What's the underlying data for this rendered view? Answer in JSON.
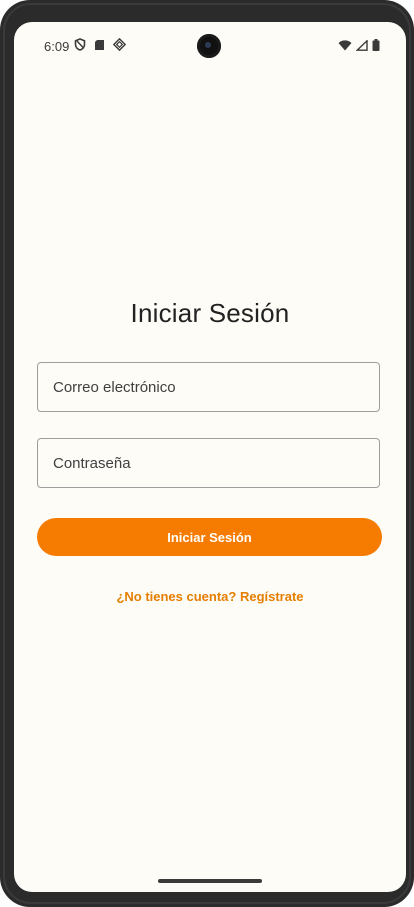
{
  "status_bar": {
    "time": "6:09",
    "left_icons": [
      "shield-icon",
      "sd-card-icon",
      "assistant-icon"
    ],
    "right_icons": [
      "wifi-icon",
      "cell-signal-icon",
      "battery-icon"
    ]
  },
  "login": {
    "title": "Iniciar Sesión",
    "email_placeholder": "Correo electrónico",
    "password_placeholder": "Contraseña",
    "submit_label": "Iniciar Sesión",
    "register_link": "¿No tienes cuenta? Regístrate"
  },
  "colors": {
    "accent": "#f57c00",
    "link": "#e67e00",
    "background": "#fdfcf7"
  }
}
